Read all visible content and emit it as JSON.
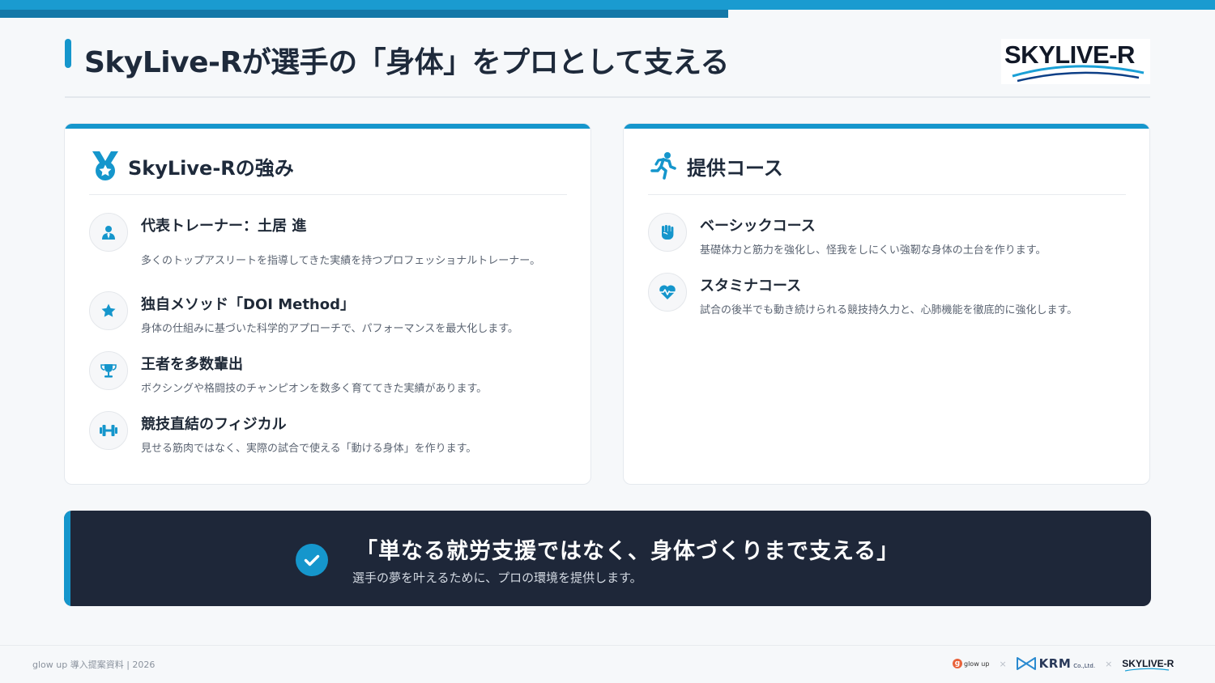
{
  "header": {
    "title": "SkyLive-Rが選手の「身体」をプロとして支える",
    "logo_text": "SKYLIVE-R"
  },
  "colors": {
    "accent": "#1596cc",
    "accent_dark": "#1478a8",
    "navy": "#1e2739",
    "text": "#1f2937"
  },
  "strengths": {
    "title": "SkyLive-Rの強み",
    "icon": "medal-icon",
    "items": [
      {
        "icon": "user-tie-icon",
        "title": "代表トレーナー：土居 進",
        "desc": "多くのトップアスリートを指導してきた実績を持つプロフェッショナルトレーナー。"
      },
      {
        "icon": "star-icon",
        "title": "独自メソッド「DOI Method」",
        "desc": "身体の仕組みに基づいた科学的アプローチで、パフォーマンスを最大化します。"
      },
      {
        "icon": "trophy-icon",
        "title": "王者を多数輩出",
        "desc": "ボクシングや格闘技のチャンピオンを数多く育ててきた実績があります。"
      },
      {
        "icon": "dumbbell-icon",
        "title": "競技直結のフィジカル",
        "desc": "見せる筋肉ではなく、実際の試合で使える「動ける身体」を作ります。"
      }
    ]
  },
  "courses": {
    "title": "提供コース",
    "icon": "running-icon",
    "items": [
      {
        "icon": "fist-icon",
        "title": "ベーシックコース",
        "desc": "基礎体力と筋力を強化し、怪我をしにくい強靭な身体の土台を作ります。"
      },
      {
        "icon": "heart-pulse-icon",
        "title": "スタミナコース",
        "desc": "試合の後半でも動き続けられる競技持久力と、心肺機能を徹底的に強化します。"
      }
    ]
  },
  "banner": {
    "quote": "「単なる就労支援ではなく、身体づくりまで支える」",
    "sub": "選手の夢を叶えるために、プロの環境を提供します。"
  },
  "footer": {
    "left": "glow up 導入提案資料 | 2026",
    "separator": "×",
    "logo1": "glow up",
    "logo1_mark": "g",
    "logo2": "KRM",
    "logo2_suffix": "Co.,Ltd.",
    "logo3": "SKYLIVE-R"
  }
}
